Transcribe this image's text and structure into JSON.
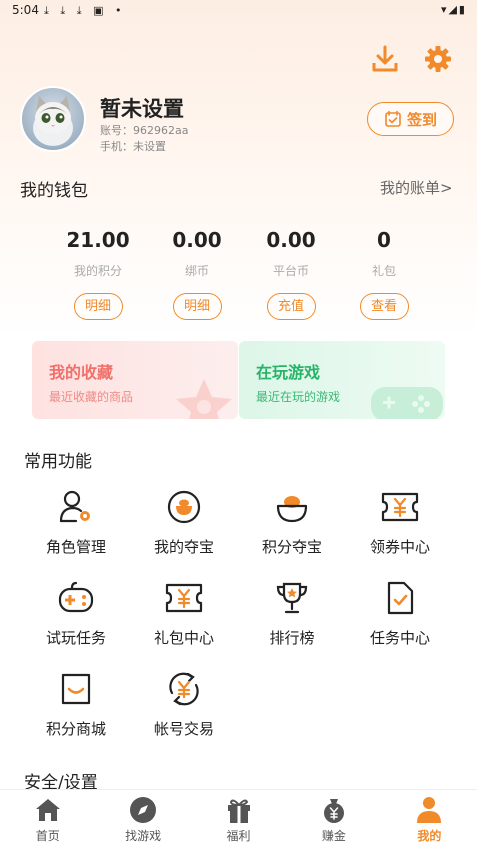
{
  "status_bar": {
    "time": "5:04",
    "left_icons": "⤓ ⤓ ⤓ ▣ •",
    "right_icons": "▾◢▮"
  },
  "header": {
    "download_icon": "download-icon",
    "settings_icon": "gear-icon"
  },
  "profile": {
    "nickname": "暂未设置",
    "account": "账号：962962aa",
    "phone": "手机：未设置",
    "checkin_label": "签到"
  },
  "wallet": {
    "title": "我的钱包",
    "bill_link": "我的账单>",
    "items": [
      {
        "value": "21.00",
        "label": "我的积分",
        "action": "明细"
      },
      {
        "value": "0.00",
        "label": "绑币",
        "action": "明细"
      },
      {
        "value": "0.00",
        "label": "平台币",
        "action": "充值"
      },
      {
        "value": "0",
        "label": "礼包",
        "action": "查看"
      }
    ]
  },
  "cards": [
    {
      "title": "我的收藏",
      "subtitle": "最近收藏的商品"
    },
    {
      "title": "在玩游戏",
      "subtitle": "最近在玩的游戏"
    }
  ],
  "functions": {
    "title": "常用功能",
    "items": [
      {
        "label": "角色管理",
        "icon": "role-manage-icon"
      },
      {
        "label": "我的夺宝",
        "icon": "my-treasure-icon"
      },
      {
        "label": "积分夺宝",
        "icon": "points-treasure-icon"
      },
      {
        "label": "领券中心",
        "icon": "coupon-icon"
      },
      {
        "label": "试玩任务",
        "icon": "gamepad-icon"
      },
      {
        "label": "礼包中心",
        "icon": "gift-pack-icon"
      },
      {
        "label": "排行榜",
        "icon": "trophy-icon"
      },
      {
        "label": "任务中心",
        "icon": "task-icon"
      },
      {
        "label": "积分商城",
        "icon": "shop-bag-icon"
      },
      {
        "label": "帐号交易",
        "icon": "account-trade-icon"
      }
    ]
  },
  "security": {
    "title": "安全/设置"
  },
  "tabbar": [
    {
      "label": "首页",
      "icon": "home-icon"
    },
    {
      "label": "找游戏",
      "icon": "compass-icon"
    },
    {
      "label": "福利",
      "icon": "gift-icon"
    },
    {
      "label": "赚金",
      "icon": "money-bag-icon"
    },
    {
      "label": "我的",
      "icon": "user-icon",
      "active": true
    }
  ],
  "colors": {
    "accent": "#f08a2b",
    "pink_card": "#fde4e4",
    "green_card": "#dff6ea"
  }
}
